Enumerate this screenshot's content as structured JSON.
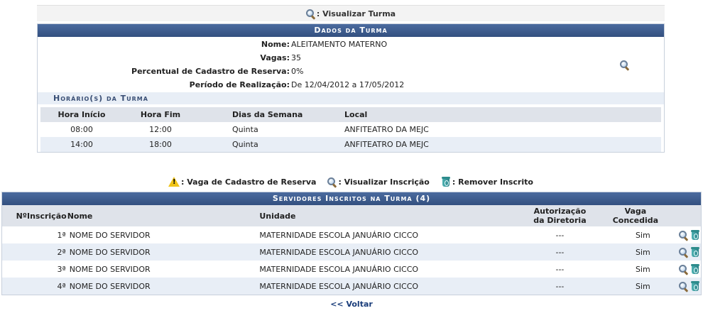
{
  "top_legend": {
    "label": ": Visualizar Turma"
  },
  "turma": {
    "caption": "Dados da Turma",
    "fields": [
      {
        "label": "Nome:",
        "value": "ALEITAMENTO MATERNO"
      },
      {
        "label": "Vagas:",
        "value": "35"
      },
      {
        "label": "Percentual de Cadastro de Reserva:",
        "value": "0%"
      },
      {
        "label": "Período de Realização:",
        "value": "De 12/04/2012 a 17/05/2012"
      }
    ],
    "horarios_caption": "Horário(s) da Turma",
    "horarios_headers": [
      "Hora Início",
      "Hora Fim",
      "Dias da Semana",
      "Local"
    ],
    "horarios": [
      {
        "inicio": "08:00",
        "fim": "12:00",
        "dias": "Quinta",
        "local": "ANFITEATRO DA MEJC"
      },
      {
        "inicio": "14:00",
        "fim": "18:00",
        "dias": "Quinta",
        "local": "ANFITEATRO DA MEJC"
      }
    ]
  },
  "legend2": {
    "reserva": ": Vaga de Cadastro de Reserva",
    "visualizar": ": Visualizar Inscrição",
    "remover": ": Remover Inscrito"
  },
  "inscritos": {
    "caption": "Servidores Inscritos na Turma (4)",
    "headers": {
      "num": "NºInscrição",
      "nome": "Nome",
      "unidade": "Unidade",
      "autorizacao_l1": "Autorização",
      "autorizacao_l2": "da Diretoria",
      "vaga_l1": "Vaga",
      "vaga_l2": "Concedida"
    },
    "rows": [
      {
        "num": "1ª",
        "nome": "NOME DO SERVIDOR",
        "unidade": "MATERNIDADE ESCOLA JANUÁRIO CICCO",
        "autorizacao": "---",
        "vaga": "Sim"
      },
      {
        "num": "2ª",
        "nome": "NOME DO SERVIDOR",
        "unidade": "MATERNIDADE ESCOLA JANUÁRIO CICCO",
        "autorizacao": "---",
        "vaga": "Sim"
      },
      {
        "num": "3ª",
        "nome": "NOME DO SERVIDOR",
        "unidade": "MATERNIDADE ESCOLA JANUÁRIO CICCO",
        "autorizacao": "---",
        "vaga": "Sim"
      },
      {
        "num": "4ª",
        "nome": "NOME DO SERVIDOR",
        "unidade": "MATERNIDADE ESCOLA JANUÁRIO CICCO",
        "autorizacao": "---",
        "vaga": "Sim"
      }
    ]
  },
  "voltar": "<< Voltar",
  "icons": [
    "magnifier-icon",
    "warning-icon",
    "trash-icon"
  ]
}
